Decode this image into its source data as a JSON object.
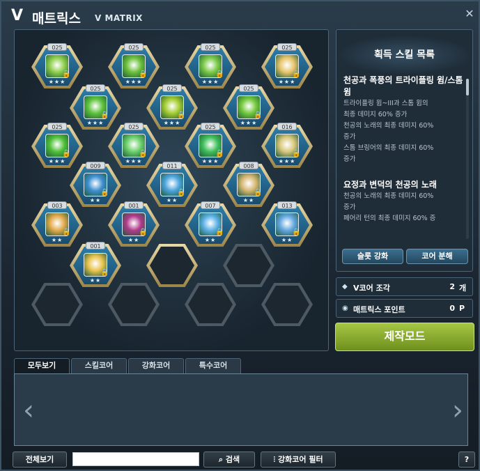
{
  "window": {
    "title_v": "V",
    "title_kr": "매트릭스",
    "title_en": "V MATRIX",
    "close_glyph": "✕"
  },
  "matrix": {
    "slots": [
      {
        "level": "025",
        "filled": true,
        "color": "#8ecf4a",
        "stars": "★★★",
        "locked": true
      },
      {
        "level": "025",
        "filled": true,
        "color": "#6bbf3a",
        "stars": "★★★",
        "locked": true
      },
      {
        "level": "025",
        "filled": true,
        "color": "#79c846",
        "stars": "★★★",
        "locked": true
      },
      {
        "level": "025",
        "filled": true,
        "color": "#e7c46a",
        "stars": "★★★",
        "locked": true
      },
      {
        "level": "025",
        "filled": true,
        "color": "#5ec23c",
        "stars": "★★★",
        "locked": true
      },
      {
        "level": "025",
        "filled": true,
        "color": "#a3cb2f",
        "stars": "★★★",
        "locked": true
      },
      {
        "level": "025",
        "filled": true,
        "color": "#73c93b",
        "stars": "★★★",
        "locked": true
      },
      {
        "level": "025",
        "filled": true,
        "color": "#4fc037",
        "stars": "★★★",
        "locked": true
      },
      {
        "level": "025",
        "filled": true,
        "color": "#6bcf6a",
        "stars": "★★★",
        "locked": true
      },
      {
        "level": "025",
        "filled": true,
        "color": "#3fbf5a",
        "stars": "★★★",
        "locked": true
      },
      {
        "level": "016",
        "filled": true,
        "color": "#d8c77a",
        "stars": "★★★",
        "locked": true
      },
      {
        "level": "009",
        "filled": true,
        "color": "#3d8ed0",
        "stars": "★★",
        "locked": true
      },
      {
        "level": "011",
        "filled": true,
        "color": "#4aa3dc",
        "stars": "★★",
        "locked": true
      },
      {
        "level": "008",
        "filled": true,
        "color": "#d5b570",
        "stars": "★★",
        "locked": true
      },
      {
        "level": "003",
        "filled": true,
        "color": "#e2a94a",
        "stars": "★★",
        "locked": true
      },
      {
        "level": "001",
        "filled": true,
        "color": "#b03a8a",
        "stars": "★★",
        "locked": true
      },
      {
        "level": "007",
        "filled": true,
        "color": "#5ab0e4",
        "stars": "★★",
        "locked": true
      },
      {
        "level": "013",
        "filled": true,
        "color": "#62a6e0",
        "stars": "★★",
        "locked": true
      },
      {
        "level": "001",
        "filled": true,
        "color": "#e8c24c",
        "stars": "★★",
        "locked": true
      },
      {
        "level": "",
        "filled": false,
        "highlighted": true
      },
      {
        "level": "",
        "filled": false
      },
      {
        "level": "",
        "filled": false
      },
      {
        "level": "",
        "filled": false
      },
      {
        "level": "",
        "filled": false
      },
      {
        "level": "",
        "filled": false
      }
    ]
  },
  "skill_panel": {
    "title": "획득 스킬 목록",
    "entries": [
      {
        "name": "천공과 폭풍의 트라이플링 윔/스톰 윔",
        "desc": [
          "트라이플링 윔~III과 스톰 윔의",
          "최종 데미지 60% 증가",
          "천공의 노래의 최종 데미지 60%",
          "증가",
          "스톰 브링어의 최종 데미지 60%",
          "증가"
        ]
      },
      {
        "name": "요정과 변덕의 천공의 노래",
        "desc": [
          "천공의 노래의 최종 데미지 60%",
          "증가",
          "페어리 턴의 최종 데미지 60% 증"
        ]
      }
    ],
    "slot_upgrade_label": "슬롯 강화",
    "core_disassemble_label": "코어 분해"
  },
  "stats": {
    "v_core_shard_label": "V코어 조각",
    "v_core_shard_value": "2",
    "v_core_shard_unit": "개",
    "matrix_point_label": "매트릭스 포인트",
    "matrix_point_value": "0",
    "matrix_point_unit": "P"
  },
  "craft_mode_label": "제작모드",
  "tabs": [
    {
      "label": "모두보기",
      "active": true
    },
    {
      "label": "스킬코어",
      "active": false
    },
    {
      "label": "강화코어",
      "active": false
    },
    {
      "label": "특수코어",
      "active": false
    }
  ],
  "inventory": {
    "prev_arrow": "‹",
    "next_arrow": "›"
  },
  "bottom": {
    "view_all_label": "전체보기",
    "search_value": "",
    "search_label": "검색",
    "filter_label": "강화코어 필터",
    "help_label": "?"
  }
}
